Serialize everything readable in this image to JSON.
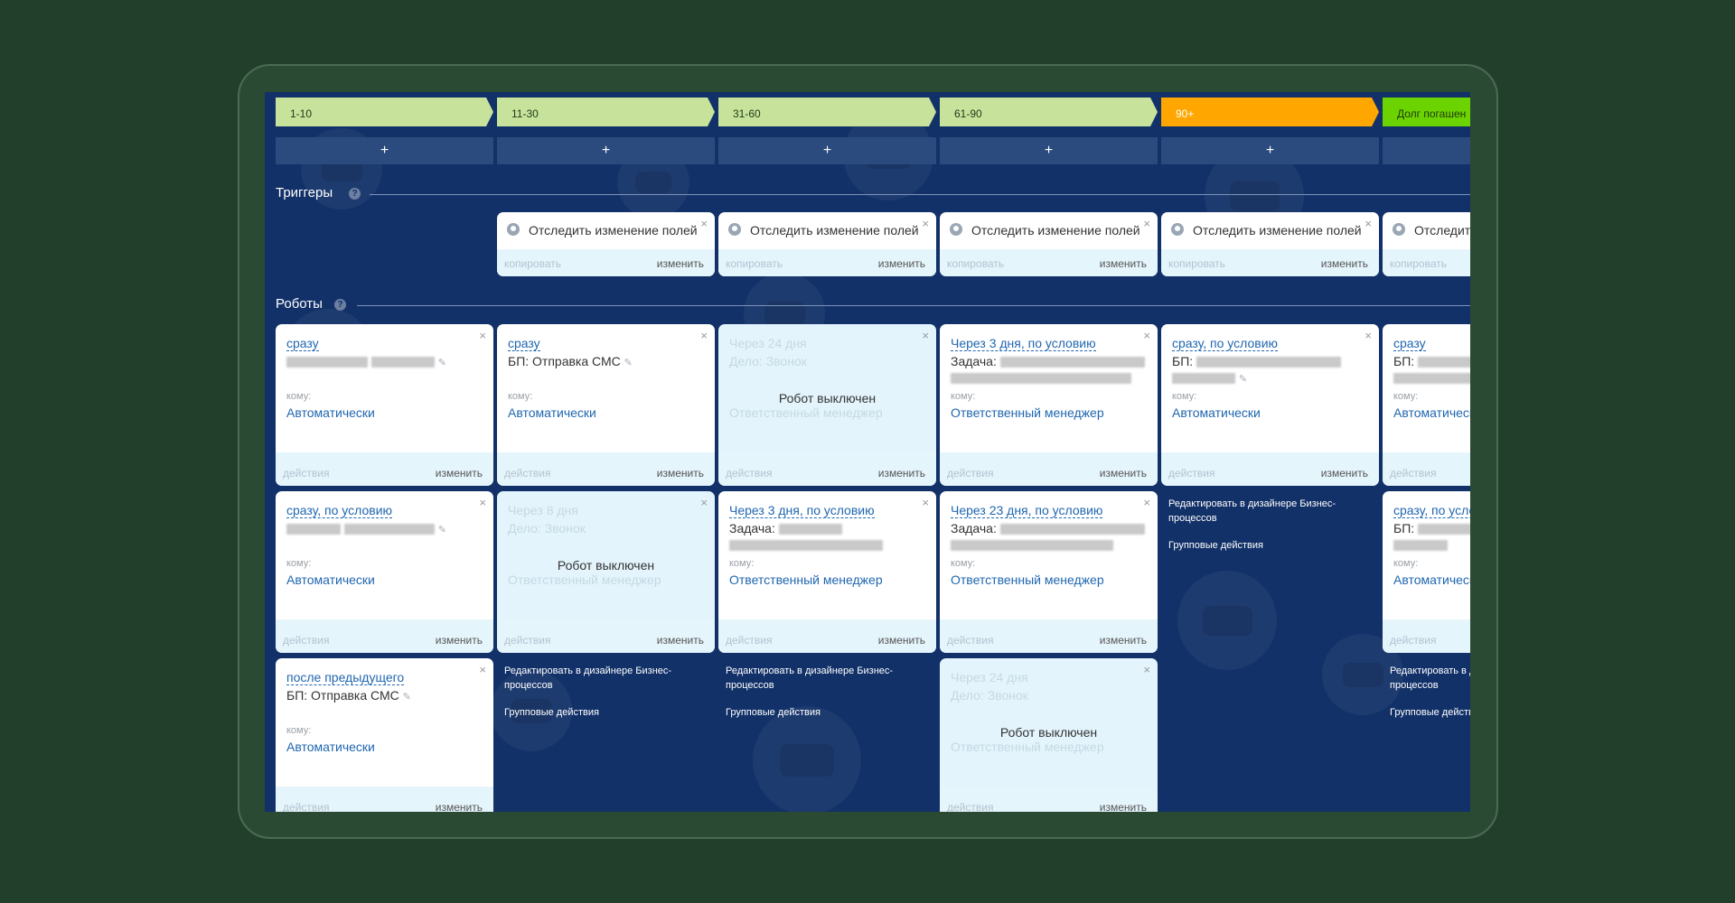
{
  "stages": [
    {
      "label": "1-10",
      "color": "#c7e39b"
    },
    {
      "label": "11-30",
      "color": "#c7e39b"
    },
    {
      "label": "31-60",
      "color": "#c7e39b"
    },
    {
      "label": "61-90",
      "color": "#c7e39b"
    },
    {
      "label": "90+",
      "color": "#ffa700"
    },
    {
      "label": "Долг погашен",
      "color": "#6bd400"
    }
  ],
  "add_label": "+",
  "sections": {
    "triggers": "Триггеры",
    "robots": "Роботы",
    "help": "?"
  },
  "trigger": {
    "label": "Отследить изменение полей",
    "copy": "копировать",
    "edit": "изменить",
    "close": "×"
  },
  "robot_common": {
    "actions": "действия",
    "edit": "изменить",
    "to_label": "кому:",
    "off": "Робот выключен",
    "close": "×",
    "pencil": "✎"
  },
  "robots": {
    "c1r1": {
      "delay": "сразу",
      "to": "Автоматически"
    },
    "c2r1": {
      "delay": "сразу",
      "title": "БП: Отправка СМС",
      "to": "Автоматически"
    },
    "c3r1": {
      "faded1": "Через 24 дня",
      "faded2": "Дело: Звонок",
      "faded3": "Ответственный менеджер"
    },
    "c4r1": {
      "delay": "Через 3 дня, по условию",
      "title": "Задача:",
      "to": "Ответственный менеджер"
    },
    "c5r1": {
      "delay": "сразу, по условию",
      "title": "БП:",
      "to": "Автоматически"
    },
    "c6r1": {
      "delay": "сразу",
      "title": "БП:",
      "to": "Автоматически"
    },
    "c1r2": {
      "delay": "сразу, по условию",
      "to": "Автоматически"
    },
    "c2r2": {
      "faded1": "Через 8 дня",
      "faded2": "Дело: Звонок",
      "faded3": "Ответственный менеджер"
    },
    "c3r2": {
      "delay": "Через 3 дня, по условию",
      "title": "Задача:",
      "to": "Ответственный менеджер"
    },
    "c4r2": {
      "delay": "Через 23 дня, по условию",
      "title": "Задача:",
      "to": "Ответственный менеджер"
    },
    "c6r2": {
      "delay": "сразу, по условию",
      "title": "БП:",
      "to": "Автоматически"
    },
    "c1r3": {
      "delay": "после предыдущего",
      "title": "БП: Отправка СМС",
      "to": "Автоматически"
    },
    "c4r3": {
      "faded1": "Через 24 дня",
      "faded2": "Дело: Звонок",
      "faded3": "Ответственный менеджер"
    }
  },
  "column_footer": {
    "designer": "Редактировать в дизайнере Бизнес-процессов",
    "group": "Групповые действия"
  }
}
